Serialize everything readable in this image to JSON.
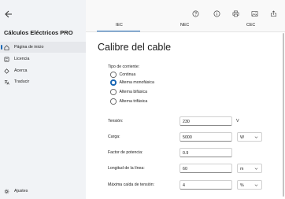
{
  "app": {
    "title": "Cálculos Eléctricos PRO"
  },
  "sidebar": {
    "items": [
      {
        "label": "Página de inicio",
        "icon": "home-icon"
      },
      {
        "label": "Licencia",
        "icon": "license-icon"
      },
      {
        "label": "Acerca",
        "icon": "info-icon"
      },
      {
        "label": "Traducir",
        "icon": "translate-icon"
      }
    ],
    "settings_label": "Ajustes"
  },
  "tabs": [
    {
      "label": "IEC"
    },
    {
      "label": "NEC"
    },
    {
      "label": "CEC"
    }
  ],
  "page": {
    "title": "Calibre del cable",
    "current_type_label": "Tipo de corriente:",
    "current_types": [
      {
        "label": "Continua",
        "checked": false
      },
      {
        "label": "Alterna monofásica",
        "checked": true
      },
      {
        "label": "Alterna bifásica",
        "checked": false
      },
      {
        "label": "Alterna trifásica",
        "checked": false
      }
    ],
    "fields": {
      "voltage": {
        "label": "Tensión:",
        "value": "230",
        "unit": "V"
      },
      "load": {
        "label": "Carga:",
        "value": "5000",
        "unit": "W"
      },
      "power_factor": {
        "label": "Factor de potencia:",
        "value": "0.9"
      },
      "line_length": {
        "label": "Longitud de la línea:",
        "value": "60",
        "unit": "m"
      },
      "max_voltage_drop": {
        "label": "Máxima caída de tensión:",
        "value": "4",
        "unit": "%"
      }
    }
  },
  "colors": {
    "accent": "#1a67b5"
  }
}
